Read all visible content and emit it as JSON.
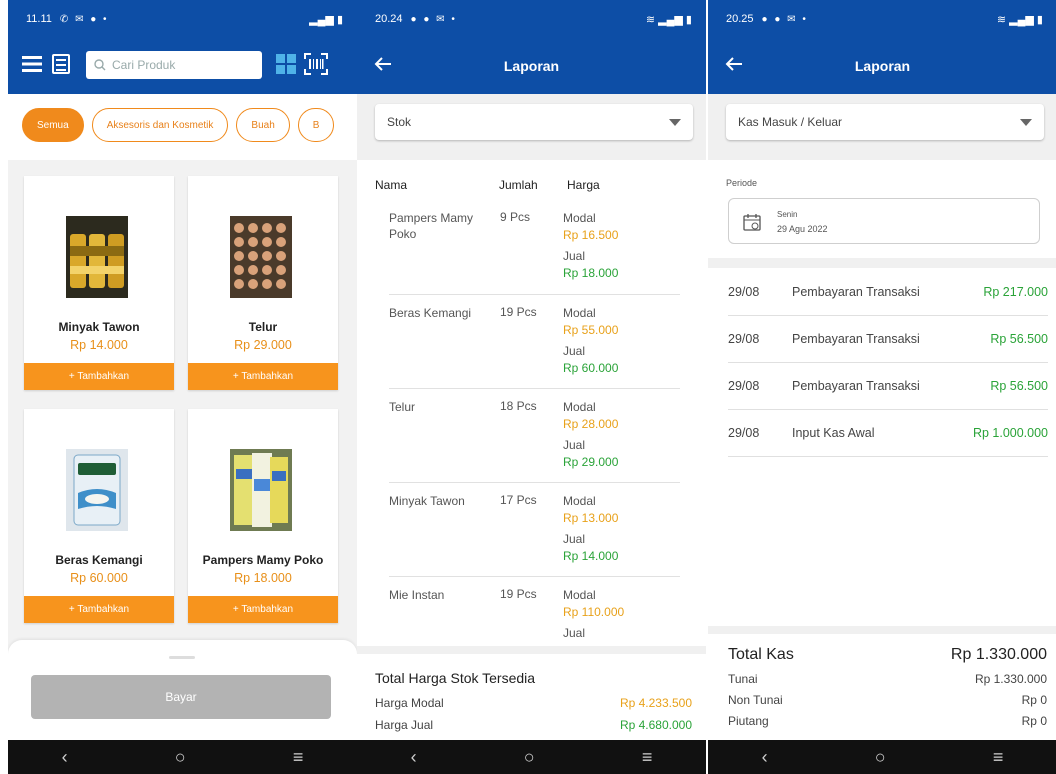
{
  "colors": {
    "primary": "#0d4ea6",
    "accent": "#f7941d",
    "money_orange": "#e8a11a",
    "money_green": "#2aa338"
  },
  "screen1": {
    "status": {
      "time": "11.11",
      "signal": "⁴ᴳ"
    },
    "search_placeholder": "Cari Produk",
    "chips": [
      "Semua",
      "Aksesoris dan Kosmetik",
      "Buah",
      "B"
    ],
    "products": [
      {
        "name": "Minyak Tawon",
        "price": "Rp 14.000",
        "add": "+ Tambahkan",
        "icon": "oil-bottles-image"
      },
      {
        "name": "Telur",
        "price": "Rp 29.000",
        "add": "+ Tambahkan",
        "icon": "egg-tray-image"
      },
      {
        "name": "Beras Kemangi",
        "price": "Rp 60.000",
        "add": "+ Tambahkan",
        "icon": "rice-bag-image"
      },
      {
        "name": "Pampers Mamy Poko",
        "price": "Rp 18.000",
        "add": "+ Tambahkan",
        "icon": "diaper-pack-image"
      }
    ],
    "pay_label": "Bayar"
  },
  "screen2": {
    "status": {
      "time": "20.24"
    },
    "title": "Laporan",
    "dropdown": "Stok",
    "headers": {
      "name": "Nama",
      "qty": "Jumlah",
      "price": "Harga"
    },
    "rows": [
      {
        "name": "Pampers Mamy Poko",
        "qty": "9 Pcs",
        "modal_label": "Modal",
        "modal": "Rp 16.500",
        "jual_label": "Jual",
        "jual": "Rp 18.000"
      },
      {
        "name": "Beras Kemangi",
        "qty": "19 Pcs",
        "modal_label": "Modal",
        "modal": "Rp 55.000",
        "jual_label": "Jual",
        "jual": "Rp 60.000"
      },
      {
        "name": "Telur",
        "qty": "18 Pcs",
        "modal_label": "Modal",
        "modal": "Rp 28.000",
        "jual_label": "Jual",
        "jual": "Rp 29.000"
      },
      {
        "name": "Minyak Tawon",
        "qty": "17 Pcs",
        "modal_label": "Modal",
        "modal": "Rp 13.000",
        "jual_label": "Jual",
        "jual": "Rp 14.000"
      },
      {
        "name": "Mie Instan",
        "qty": "19 Pcs",
        "modal_label": "Modal",
        "modal": "Rp 110.000",
        "jual_label": "Jual",
        "jual": ""
      }
    ],
    "totals": {
      "title": "Total Harga Stok Tersedia",
      "modal_label": "Harga Modal",
      "modal": "Rp 4.233.500",
      "jual_label": "Harga Jual",
      "jual": "Rp 4.680.000"
    }
  },
  "screen3": {
    "status": {
      "time": "20.25"
    },
    "title": "Laporan",
    "dropdown": "Kas Masuk / Keluar",
    "periode_label": "Periode",
    "day": "Senin",
    "date": "29 Agu 2022",
    "rows": [
      {
        "date": "29/08",
        "desc": "Pembayaran Transaksi",
        "amount": "Rp 217.000"
      },
      {
        "date": "29/08",
        "desc": "Pembayaran Transaksi",
        "amount": "Rp 56.500"
      },
      {
        "date": "29/08",
        "desc": "Pembayaran Transaksi",
        "amount": "Rp 56.500"
      },
      {
        "date": "29/08",
        "desc": "Input Kas Awal",
        "amount": "Rp 1.000.000"
      }
    ],
    "total": {
      "label": "Total Kas",
      "value": "Rp 1.330.000",
      "tunai_label": "Tunai",
      "tunai": "Rp 1.330.000",
      "non_label": "Non Tunai",
      "non": "Rp 0",
      "piutang_label": "Piutang",
      "piutang": "Rp 0"
    }
  }
}
